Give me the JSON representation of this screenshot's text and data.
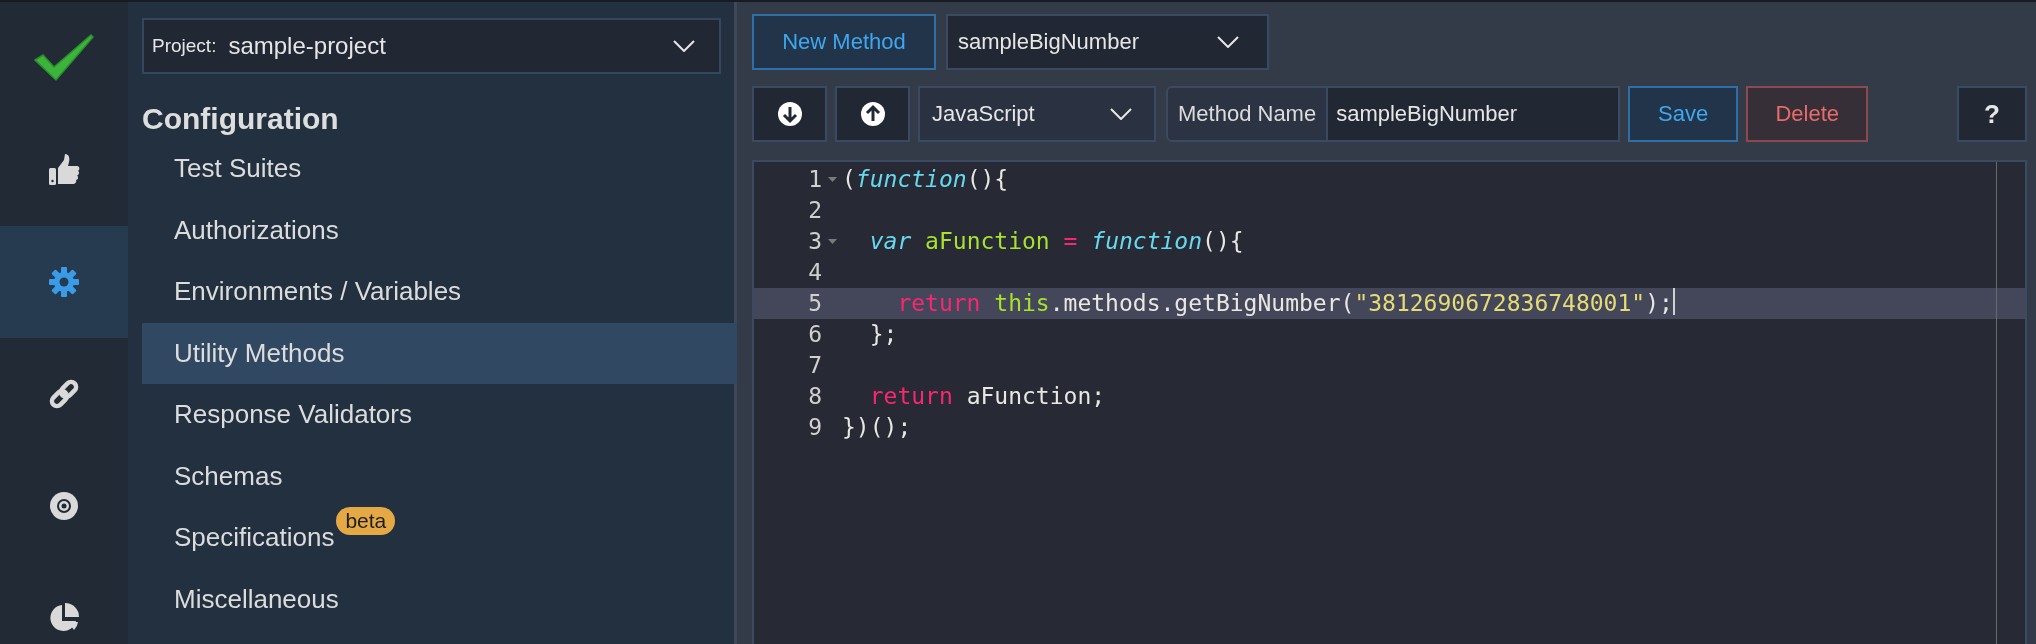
{
  "rail": [
    {
      "kind": "logo",
      "selected": false
    },
    {
      "kind": "thumbs-up",
      "selected": false
    },
    {
      "kind": "gear",
      "selected": true
    },
    {
      "kind": "link",
      "selected": false
    },
    {
      "kind": "disc",
      "selected": false
    },
    {
      "kind": "pie",
      "selected": false
    }
  ],
  "sidebar": {
    "project": {
      "label": "Project:",
      "value": "sample-project"
    },
    "heading": "Configuration",
    "items": [
      {
        "label": "Test Suites",
        "selected": false
      },
      {
        "label": "Authorizations",
        "selected": false
      },
      {
        "label": "Environments / Variables",
        "selected": false
      },
      {
        "label": "Utility Methods",
        "selected": true
      },
      {
        "label": "Response Validators",
        "selected": false
      },
      {
        "label": "Schemas",
        "selected": false
      },
      {
        "label": "Specifications",
        "selected": false,
        "badge": "beta"
      },
      {
        "label": "Miscellaneous",
        "selected": false
      }
    ]
  },
  "toolbar": {
    "new_button": "New Method",
    "method_select": "sampleBigNumber",
    "language_select": "JavaScript",
    "method_name_label": "Method Name",
    "method_name_value": "sampleBigNumber",
    "save_button": "Save",
    "delete_button": "Delete",
    "help_button": "?"
  },
  "editor": {
    "lines": [
      {
        "number": "1",
        "fold": true,
        "active": false,
        "tokens": [
          {
            "kind": "plain",
            "text": "("
          },
          {
            "kind": "storage",
            "text": "function"
          },
          {
            "kind": "plain",
            "text": "(){"
          }
        ]
      },
      {
        "number": "2",
        "fold": false,
        "active": false
      },
      {
        "number": "3",
        "fold": true,
        "active": false,
        "tokens": [
          {
            "kind": "storage",
            "text": "  var"
          },
          {
            "kind": "entity",
            "text": " aFunction"
          },
          {
            "kind": "keyword",
            "text": " ="
          },
          {
            "kind": "storage",
            "text": " function"
          },
          {
            "kind": "plain",
            "text": "(){"
          }
        ]
      },
      {
        "number": "4",
        "fold": false,
        "active": false
      },
      {
        "number": "5",
        "fold": false,
        "active": true,
        "tokens": [
          {
            "kind": "keyword",
            "text": "    return"
          },
          {
            "kind": "entity",
            "text": " this"
          },
          {
            "kind": "plain",
            "text": ".methods.getBigNumber("
          },
          {
            "kind": "string",
            "text": "\"3812690672836748001\""
          },
          {
            "kind": "plain",
            "text": ");"
          }
        ]
      },
      {
        "number": "6",
        "fold": false,
        "active": false,
        "tokens": [
          {
            "kind": "plain",
            "text": "  };"
          }
        ]
      },
      {
        "number": "7",
        "fold": false,
        "active": false
      },
      {
        "number": "8",
        "fold": false,
        "active": false,
        "tokens": [
          {
            "kind": "keyword",
            "text": "  return"
          },
          {
            "kind": "plain",
            "text": " aFunction;"
          }
        ]
      },
      {
        "number": "9",
        "fold": false,
        "active": false,
        "tokens": [
          {
            "kind": "plain",
            "text": "})();"
          }
        ]
      }
    ]
  }
}
